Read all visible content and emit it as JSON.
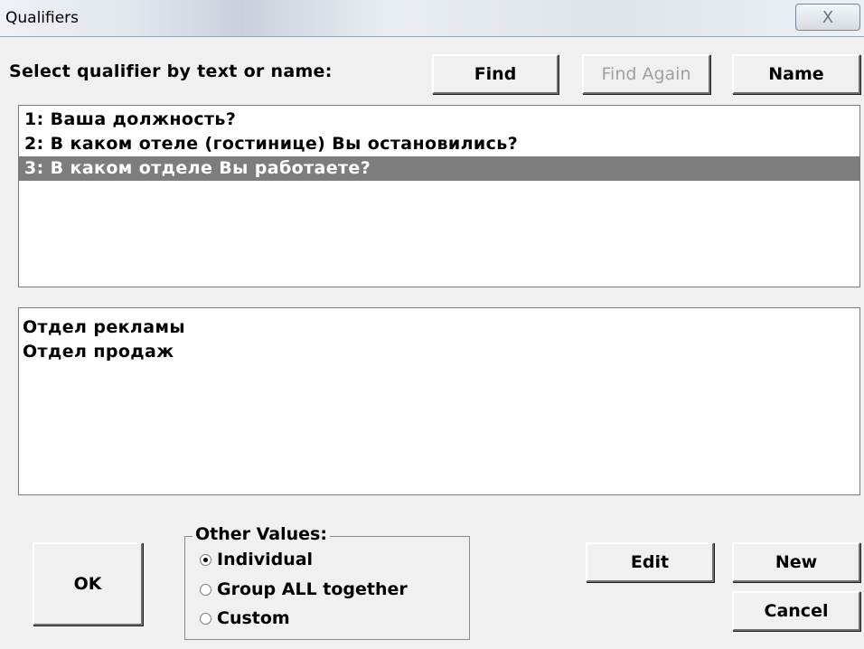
{
  "window": {
    "title": "Qualifiers",
    "close_glyph": "X"
  },
  "search": {
    "prompt": "Select qualifier by text or name:",
    "find_label": "Find",
    "find_again_label": "Find Again",
    "name_label": "Name"
  },
  "qualifiers": [
    {
      "text": "1:  Ваша должность?",
      "selected": false
    },
    {
      "text": "2:  В каком отеле (гостинице) Вы остановились?",
      "selected": false
    },
    {
      "text": "3:  В каком отделе Вы работаете?",
      "selected": true
    }
  ],
  "values": [
    "Отдел рекламы",
    "Отдел продаж"
  ],
  "other_values": {
    "legend": "Other Values:",
    "options": [
      {
        "label": "Individual",
        "checked": true
      },
      {
        "label": "Group ALL together",
        "checked": false
      },
      {
        "label": "Custom",
        "checked": false
      }
    ]
  },
  "actions": {
    "ok_label": "OK",
    "edit_label": "Edit",
    "new_label": "New",
    "cancel_label": "Cancel"
  },
  "icons": {
    "close": "close-icon",
    "radio": "radio-icon"
  }
}
